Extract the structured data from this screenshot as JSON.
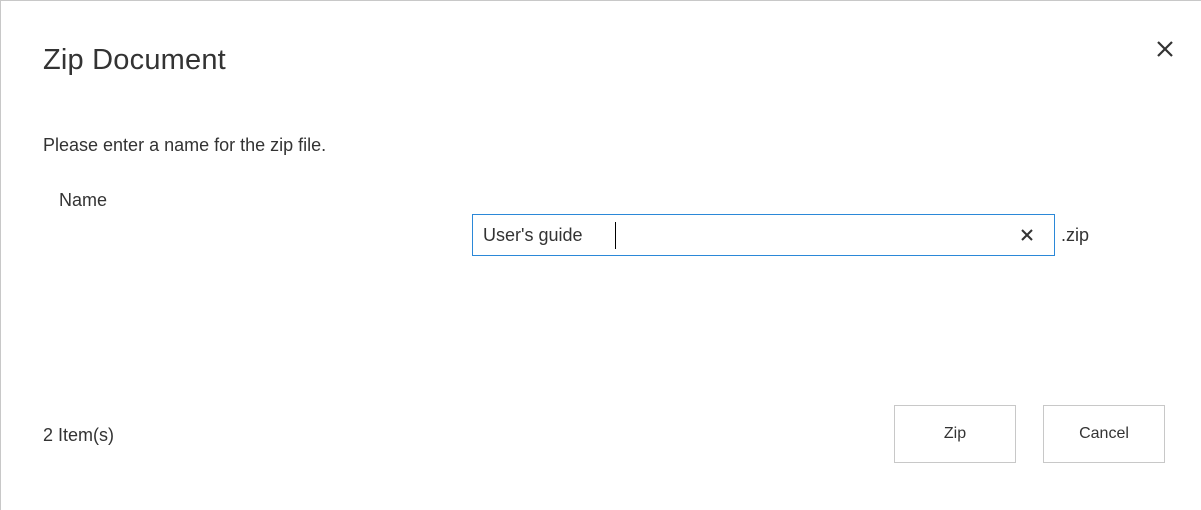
{
  "dialog": {
    "title": "Zip Document",
    "close_icon": "close-icon",
    "instruction": "Please enter a name for the zip file.",
    "name_label": "Name",
    "name_input": {
      "value": "User's guide",
      "clear_icon": "clear-icon"
    },
    "extension": ".zip",
    "item_count": "2 Item(s)",
    "buttons": {
      "zip_label": "Zip",
      "cancel_label": "Cancel"
    }
  },
  "colors": {
    "focus_border": "#2b88d8",
    "text": "#333333",
    "button_border": "#c8c8c8"
  }
}
